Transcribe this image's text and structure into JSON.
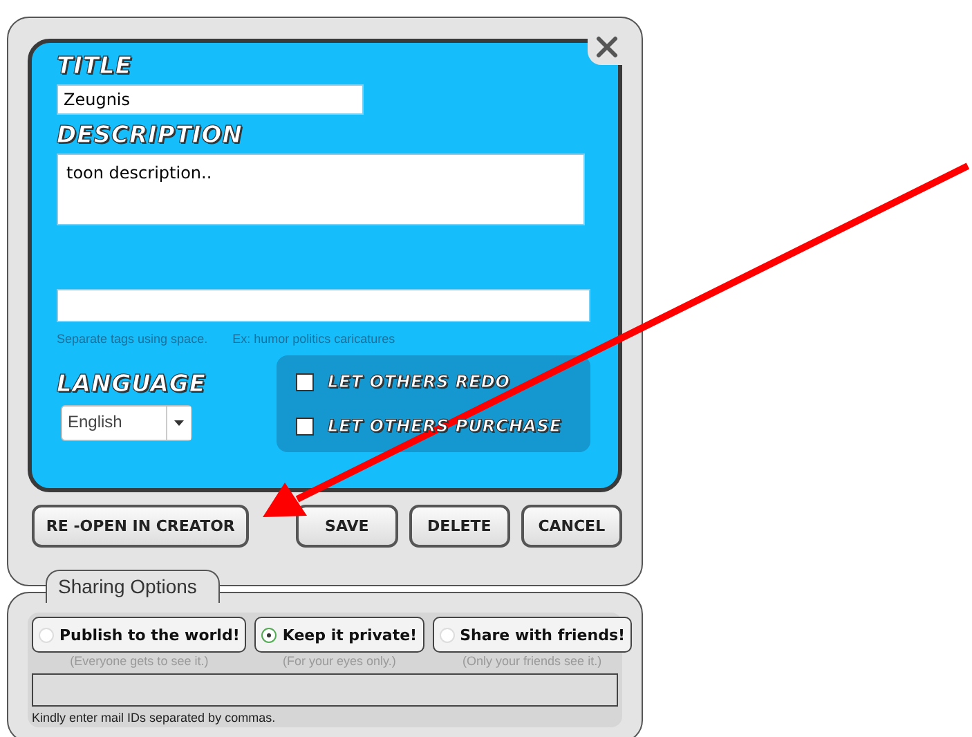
{
  "details": {
    "title_label": "TITLE",
    "title_value": "Zeugnis",
    "description_label": "DESCRIPTION",
    "description_value": "toon description..",
    "tags_hint": "Separate tags using space.",
    "tags_example": "Ex: humor politics caricatures",
    "language_label": "LANGUAGE",
    "language_value": "English",
    "permissions": [
      {
        "label": "LET OTHERS REDO",
        "checked": false
      },
      {
        "label": "LET OTHERS PURCHASE",
        "checked": false
      }
    ]
  },
  "buttons": [
    {
      "label": "RE -OPEN IN CREATOR",
      "kind": "wide"
    },
    {
      "label": "SAVE",
      "kind": "normal"
    },
    {
      "label": "DELETE",
      "kind": "normal"
    },
    {
      "label": "CANCEL",
      "kind": "normal"
    }
  ],
  "sharing": {
    "tab": "Sharing Options",
    "options": [
      {
        "label": "Publish to the world!",
        "caption": "(Everyone gets to see it.)",
        "selected": false
      },
      {
        "label": "Keep it private!",
        "caption": "(For your eyes only.)",
        "selected": true
      },
      {
        "label": "Share with friends!",
        "caption": "(Only your friends see it.)",
        "selected": false
      }
    ],
    "email_hint": "Kindly enter mail IDs separated by commas."
  }
}
